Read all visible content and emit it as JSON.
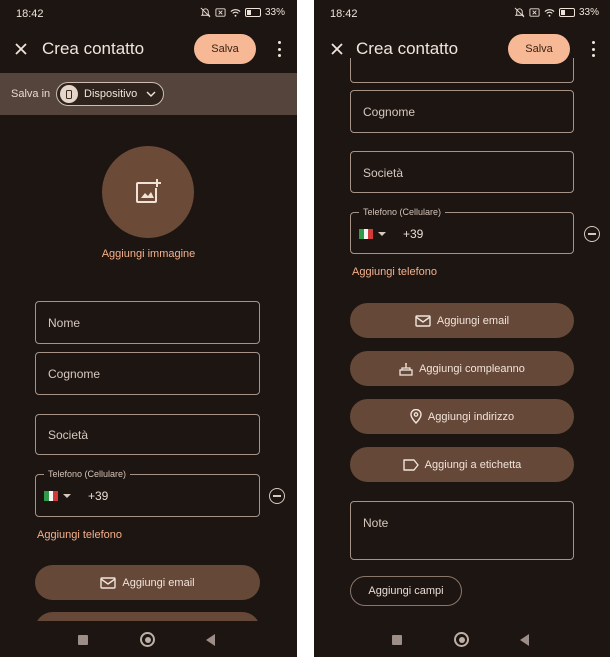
{
  "status": {
    "time": "18:42",
    "battery": "33%"
  },
  "appbar": {
    "title": "Crea contatto",
    "save_label": "Salva"
  },
  "save_location": {
    "label": "Salva in",
    "account": "Dispositivo"
  },
  "photo": {
    "add_label": "Aggiungi immagine"
  },
  "fields": {
    "first_name": "Nome",
    "last_name": "Cognome",
    "company": "Società",
    "phone_label": "Telefono (Cellulare)",
    "phone_code": "+39",
    "notes": "Note"
  },
  "actions": {
    "add_phone": "Aggiungi telefono",
    "add_email": "Aggiungi email",
    "add_birthday": "Aggiungi compleanno",
    "add_address": "Aggiungi indirizzo",
    "add_label": "Aggiungi a etichetta",
    "add_fields": "Aggiungi campi"
  },
  "colors": {
    "background": "#1d1511",
    "accent": "#f7b896",
    "pill": "#654838",
    "link": "#f4b08c"
  }
}
